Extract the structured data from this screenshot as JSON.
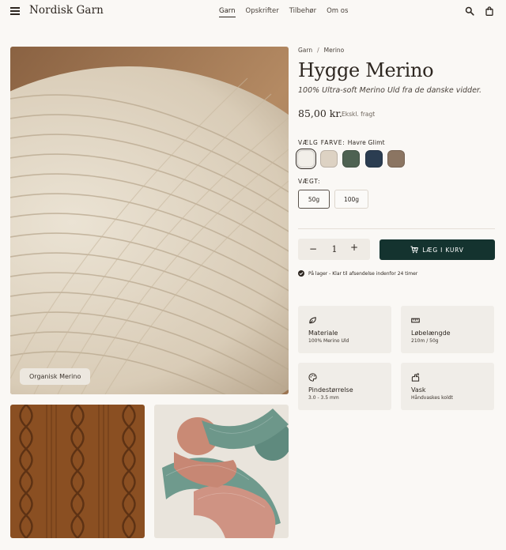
{
  "header": {
    "brand": "Nordisk Garn",
    "nav": [
      "Garn",
      "Opskrifter",
      "Tilbehør",
      "Om os"
    ],
    "active_nav": "Garn"
  },
  "gallery": {
    "badge": "Organisk Merino",
    "main_image": "cream yarn ball close-up",
    "thumbnails": [
      "brown cable-knit texture",
      "green and pink yarn skeins"
    ]
  },
  "breadcrumb": {
    "items": [
      "Garn",
      "Merino"
    ],
    "separator": "/"
  },
  "product": {
    "title": "Hygge Merino",
    "subtitle": "100% Ultra-soft Merino Uld fra de danske vidder.",
    "price": "85,00 kr.",
    "price_note": "Ekskl. fragt"
  },
  "color": {
    "label": "VÆLG FARVE:",
    "selected_name": "Havre Glimt",
    "swatches": [
      "#f2efe9",
      "#ddd2c3",
      "#4e6252",
      "#2b3d51",
      "#8b7562"
    ],
    "selected_index": 0
  },
  "weight": {
    "label": "VÆGT:",
    "options": [
      "50g",
      "100g"
    ],
    "selected_index": 0
  },
  "cart": {
    "quantity": "1",
    "minus": "−",
    "plus": "+",
    "add_label": "LÆG I KURV",
    "button_color": "#14332f"
  },
  "stock": {
    "text": "På lager - Klar til afsendelse indenfor 24 timer"
  },
  "features": [
    {
      "title": "Materiale",
      "value": "100% Merino Uld",
      "icon": "leaf-icon"
    },
    {
      "title": "Løbelængde",
      "value": "210m / 50g",
      "icon": "ruler-icon"
    },
    {
      "title": "Pindestørrelse",
      "value": "3.0 - 3.5 mm",
      "icon": "palette-icon"
    },
    {
      "title": "Vask",
      "value": "Håndvaskes koldt",
      "icon": "hand-wash-icon"
    }
  ]
}
